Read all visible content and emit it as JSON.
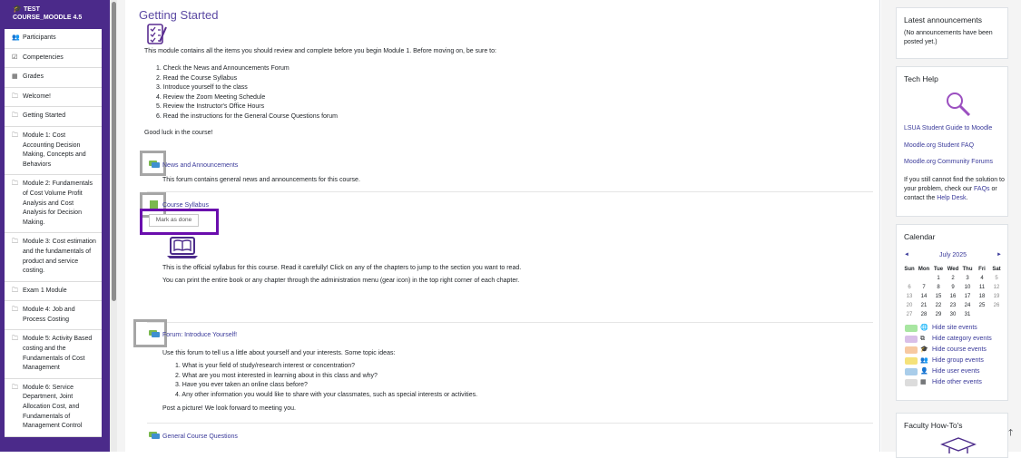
{
  "sidebar": {
    "course_line1": "TEST",
    "course_line2": "COURSE_MOODLE 4.5",
    "items": [
      {
        "label": "Participants",
        "icon": "users-icon"
      },
      {
        "label": "Competencies",
        "icon": "checkbox-icon"
      },
      {
        "label": "Grades",
        "icon": "table-icon"
      },
      {
        "label": "Welcome!",
        "icon": "folder-icon"
      },
      {
        "label": "Getting Started",
        "icon": "folder-icon"
      },
      {
        "label": "Module 1: Cost Accounting Decision Making, Concepts and Behaviors",
        "icon": "folder-icon"
      },
      {
        "label": "Module 2: Fundamentals of Cost Volume Profit Analysis and Cost Analysis for Decision Making.",
        "icon": "folder-icon"
      },
      {
        "label": "Module 3: Cost estimation and the fundamentals of product and service costing.",
        "icon": "folder-icon"
      },
      {
        "label": "Exam 1 Module",
        "icon": "folder-icon"
      },
      {
        "label": "Module 4: Job and Process Costing",
        "icon": "folder-icon"
      },
      {
        "label": "Module 5: Activity Based costing and the Fundamentals of Cost Management",
        "icon": "folder-icon"
      },
      {
        "label": "Module 6: Service Department, Joint Allocation Cost, and Fundamentals of Management Control",
        "icon": "folder-icon"
      }
    ]
  },
  "main": {
    "title": "Getting Started",
    "intro": "This module contains all the items you should review and complete before you begin Module 1. Before moving on, be sure to:",
    "steps": [
      "1. Check the News and Announcements Forum",
      "2. Read the Course Syllabus",
      "3. Introduce yourself to the class",
      "4. Review the Zoom Meeting Schedule",
      "5. Review the Instructor's Office Hours",
      "6. Read the instructions for the General Course Questions forum"
    ],
    "good_luck": "Good luck in the course!",
    "news": {
      "link": "News and Announcements",
      "desc": "This forum contains general news and announcements for this course."
    },
    "syllabus": {
      "link": "Course Syllabus",
      "mark_done": "Mark as done",
      "desc1": "This is the official syllabus for this course. Read it carefully! Click on any of the chapters to jump to the section you want to read.",
      "desc2": "You can print the entire book or any chapter through the administration menu (gear icon) in the top right corner of each chapter."
    },
    "forum": {
      "link": "Forum: Introduce Yourself!",
      "intro": "Use this forum to tell us a little about yourself and your interests. Some topic ideas:",
      "ideas": [
        "1. What is your field of study/research interest or concentration?",
        "2. What are you most interested in learning about in this class and why?",
        "3. Have you ever taken an online class before?",
        "4. Any other information you would like to share with your classmates, such as special interests or activities."
      ],
      "post": "Post a picture!  We look forward to meeting you."
    },
    "general": {
      "link": "General Course Questions"
    }
  },
  "right": {
    "announcements": {
      "title": "Latest announcements",
      "text": "(No announcements have been posted yet.)"
    },
    "tech": {
      "title": "Tech Help",
      "links": [
        "LSUA Student Guide to Moodle",
        "Moodle.org Student FAQ",
        "Moodle.org Community Forums"
      ],
      "help_prefix": "If you still cannot find the solution to your problem, check our ",
      "help_faq": "FAQs",
      "help_mid": " or contact the ",
      "help_desk": "Help Desk",
      "help_end": "."
    },
    "calendar": {
      "title": "Calendar",
      "month": "July 2025",
      "prev": "◄",
      "next": "►",
      "days": [
        "Sun",
        "Mon",
        "Tue",
        "Wed",
        "Thu",
        "Fri",
        "Sat"
      ],
      "weeks": [
        [
          "",
          "",
          "1",
          "2",
          "3",
          "4",
          "5"
        ],
        [
          "6",
          "7",
          "8",
          "9",
          "10",
          "11",
          "12"
        ],
        [
          "13",
          "14",
          "15",
          "16",
          "17",
          "18",
          "19"
        ],
        [
          "20",
          "21",
          "22",
          "23",
          "24",
          "25",
          "26"
        ],
        [
          "27",
          "28",
          "29",
          "30",
          "31",
          "",
          ""
        ]
      ],
      "events": [
        {
          "label": "Hide site events",
          "icon": "globe-icon",
          "color": "#a8e6a1"
        },
        {
          "label": "Hide category events",
          "icon": "category-icon",
          "color": "#d9bfe8"
        },
        {
          "label": "Hide course events",
          "icon": "graduation-cap-icon",
          "color": "#f7c9a1"
        },
        {
          "label": "Hide group events",
          "icon": "group-icon",
          "color": "#f5e27a"
        },
        {
          "label": "Hide user events",
          "icon": "user-icon",
          "color": "#a9cdea"
        },
        {
          "label": "Hide other events",
          "icon": "calendar-icon",
          "color": "#dcdcdc"
        }
      ]
    },
    "faculty": {
      "title": "Faculty How-To's"
    }
  }
}
